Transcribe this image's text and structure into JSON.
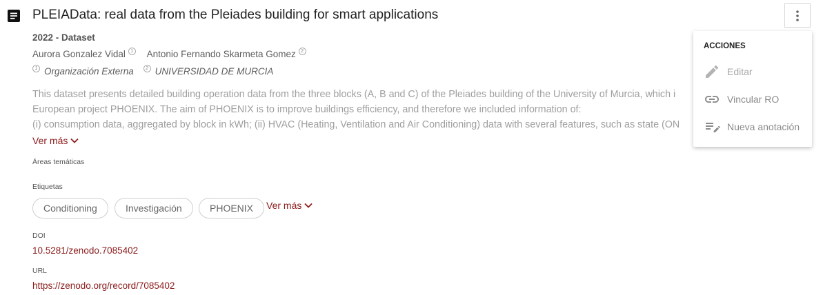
{
  "record": {
    "title": "PLEIAData: real data from the Pleiades building for smart applications",
    "year_type": "2022 - Dataset",
    "authors": [
      {
        "name": "Aurora Gonzalez Vidal",
        "affil_ref": "1"
      },
      {
        "name": "Antonio Fernando Skarmeta Gomez",
        "affil_ref": "2"
      }
    ],
    "affiliations": [
      {
        "ref": "1",
        "name": "Organización Externa"
      },
      {
        "ref": "2",
        "name": "UNIVERSIDAD DE MURCIA"
      }
    ],
    "description_lines": [
      "This dataset presents detailed building operation data from the three blocks (A, B and C) of the Pleiades building of the University of Murcia, which i",
      "European project PHOENIX. The aim of PHOENIX is to improve buildings efficiency, and therefore we included information of:",
      "(i) consumption data, aggregated by block in kWh; (ii) HVAC (Heating, Ventilation and Air Conditioning) data with several features, such as state (ON"
    ],
    "ver_mas_label": "Ver más",
    "areas_label": "Áreas temáticas",
    "tags_label": "Etiquetas",
    "tags": [
      "Conditioning",
      "Investigación",
      "PHOENIX"
    ],
    "tags_ver_mas_label": "Ver más",
    "doi_label": "DOI",
    "doi_value": "10.5281/zenodo.7085402",
    "url_label": "URL",
    "url_value": "https://zenodo.org/record/7085402"
  },
  "actions_menu": {
    "title": "ACCIONES",
    "items": [
      {
        "label": "Editar",
        "icon": "pencil-icon",
        "disabled": true
      },
      {
        "label": "Vincular RO",
        "icon": "link-icon",
        "disabled": false
      },
      {
        "label": "Nueva anotación",
        "icon": "note-add-icon",
        "disabled": false
      }
    ]
  },
  "colors": {
    "accent": "#8b1a1a",
    "text_muted": "#9e9e9e"
  }
}
